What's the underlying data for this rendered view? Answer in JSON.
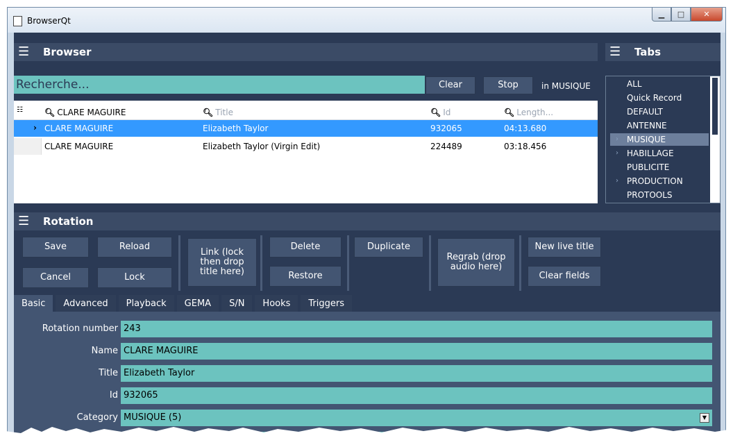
{
  "window": {
    "title": "BrowserQt"
  },
  "browser": {
    "header": "Browser",
    "search_placeholder": "Recherche...",
    "clear_label": "Clear",
    "stop_label": "Stop",
    "scope_label": "in MUSIQUE",
    "columns": [
      {
        "label": "CLARE MAGUIRE",
        "filter_active": true
      },
      {
        "label": "Title",
        "filter_active": false
      },
      {
        "label": "Id",
        "filter_active": false
      },
      {
        "label": "Length...",
        "filter_active": false
      }
    ],
    "rows": [
      {
        "name": "CLARE MAGUIRE",
        "title": "Elizabeth Taylor",
        "id": "932065",
        "length": "04:13.680",
        "selected": true
      },
      {
        "name": "CLARE MAGUIRE",
        "title": "Elizabeth Taylor (Virgin Edit)",
        "id": "224489",
        "length": "03:18.456",
        "selected": false
      }
    ]
  },
  "tabs_panel": {
    "header": "Tabs",
    "items": [
      {
        "label": "ALL",
        "expandable": false
      },
      {
        "label": "Quick Record",
        "expandable": false
      },
      {
        "label": "DEFAULT",
        "expandable": false
      },
      {
        "label": "ANTENNE",
        "expandable": false
      },
      {
        "label": "MUSIQUE",
        "expandable": true,
        "selected": true
      },
      {
        "label": "HABILLAGE",
        "expandable": true
      },
      {
        "label": "PUBLICITE",
        "expandable": false
      },
      {
        "label": "PRODUCTION",
        "expandable": true
      },
      {
        "label": "PROTOOLS",
        "expandable": false
      }
    ]
  },
  "rotation": {
    "header": "Rotation",
    "buttons": {
      "save": "Save",
      "reload": "Reload",
      "cancel": "Cancel",
      "lock": "Lock",
      "link": "Link (lock then drop title here)",
      "delete": "Delete",
      "restore": "Restore",
      "duplicate": "Duplicate",
      "regrab": "Regrab (drop audio here)",
      "new_live_title": "New live title",
      "clear_fields": "Clear fields"
    },
    "subtabs": [
      "Basic",
      "Advanced",
      "Playback",
      "GEMA",
      "S/N",
      "Hooks",
      "Triggers"
    ],
    "active_subtab": "Basic",
    "fields": [
      {
        "label": "Rotation number",
        "value": "243"
      },
      {
        "label": "Name",
        "value": "CLARE MAGUIRE"
      },
      {
        "label": "Title",
        "value": "Elizabeth Taylor"
      },
      {
        "label": "Id",
        "value": "932065"
      },
      {
        "label": "Category",
        "value": "MUSIQUE (5)"
      }
    ]
  },
  "colors": {
    "background": "#2b3a55",
    "panel_header": "#3b4b66",
    "button": "#435572",
    "field": "#6cc3bf",
    "selection": "#3399ff"
  },
  "icons": {
    "menu": "hamburger-icon",
    "filter": "magnifier-icon",
    "expand": "chevron-right-icon",
    "dropdown": "triangle-down-icon"
  }
}
